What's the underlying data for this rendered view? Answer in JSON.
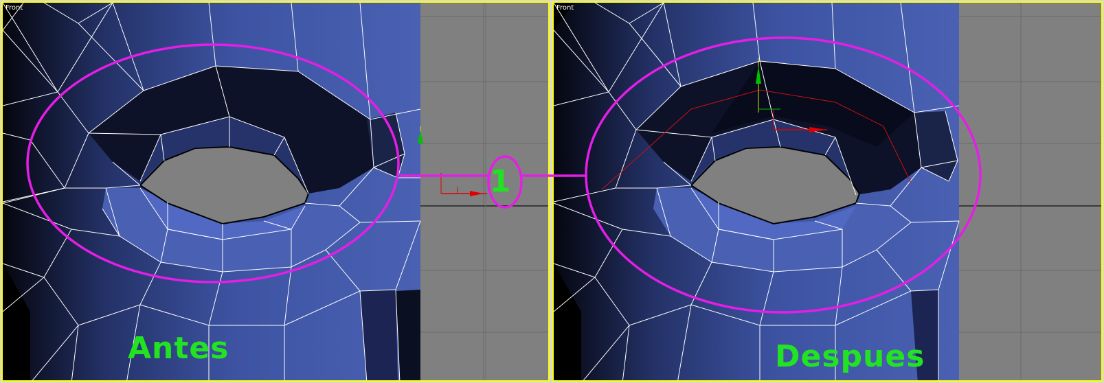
{
  "viewports": {
    "left": {
      "label": "Front"
    },
    "right": {
      "label": "Front"
    }
  },
  "captions": {
    "before": "Antes",
    "after": "Despues"
  },
  "marker": {
    "number": "1"
  },
  "colors": {
    "viewport_border": "#ffff00",
    "annotation": "#e51ee5",
    "caption": "#22e322",
    "background_grid": "#808080",
    "mesh_light": "#4a61b3",
    "mesh_dark": "#0d1228",
    "wire": "#ffffff",
    "gizmo_x": "#e00000",
    "gizmo_y": "#00c000"
  },
  "icons": {
    "gizmo": "transform-gizmo-icon",
    "annotation_ellipse": "highlight-ellipse-icon"
  }
}
